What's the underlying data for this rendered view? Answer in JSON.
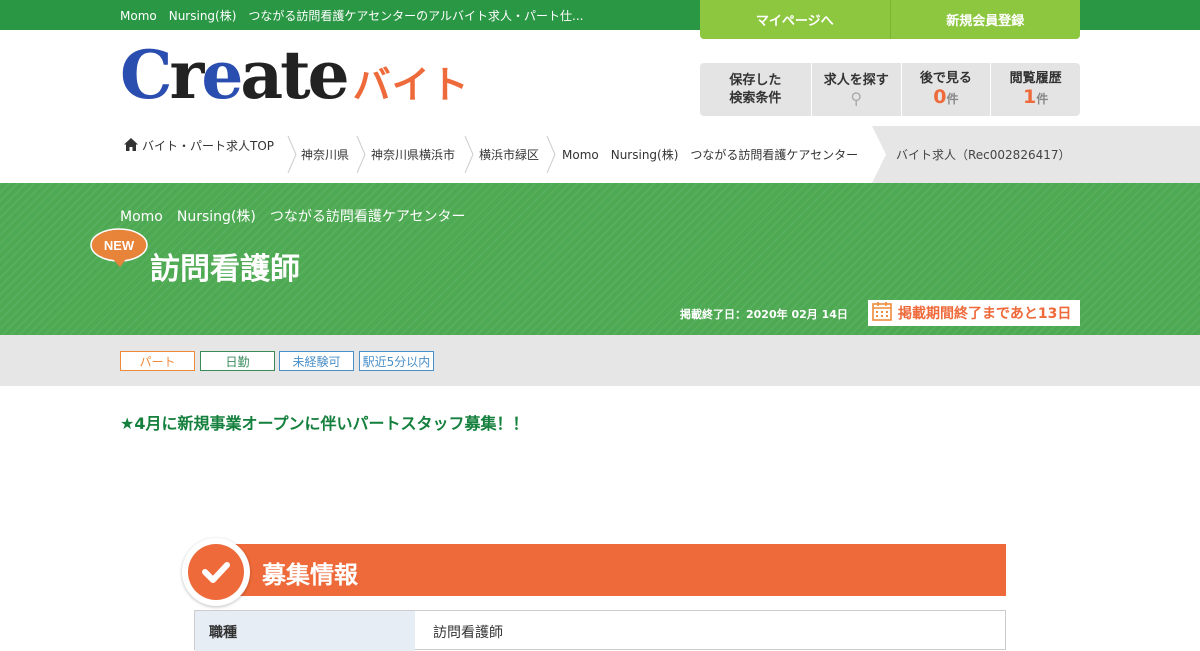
{
  "topbar": {
    "text": "Momo　Nursing(株)　つながる訪問看護ケアセンターのアルバイト求人・パート仕...",
    "mypage_label": "マイページへ",
    "register_label": "新規会員登録"
  },
  "logo": {
    "c": "C",
    "r": "r",
    "e": "e",
    "ate": "ate",
    "baito": "バイト"
  },
  "utility": {
    "saved_line1": "保存した",
    "saved_line2": "検索条件",
    "search_label": "求人を探す",
    "later_label": "後で見る",
    "later_count": "0",
    "later_unit": "件",
    "history_label": "閲覧履歴",
    "history_count": "1",
    "history_unit": "件"
  },
  "breadcrumb": {
    "home": "バイト・パート求人TOP",
    "items": [
      "神奈川県",
      "神奈川県横浜市",
      "横浜市緑区",
      "Momo　Nursing(株)　つながる訪問看護ケアセンター"
    ],
    "current": "バイト求人（Rec002826417）"
  },
  "banner": {
    "company": "Momo　Nursing(株)　つながる訪問看護ケアセンター",
    "new_badge": "NEW",
    "title": "訪問看護師",
    "end_date": "掲載終了日：2020年 02月 14日",
    "remaining": "掲載期間終了まであと13日"
  },
  "tags": [
    {
      "label": "パート",
      "color": "#ee8a3a"
    },
    {
      "label": "日勤",
      "color": "#3a8a5a"
    },
    {
      "label": "未経験可",
      "color": "#4a90c8"
    },
    {
      "label": "駅近5分以内",
      "color": "#4a90c8"
    }
  ],
  "catch_copy": "★4月に新規事業オープンに伴いパートスタッフ募集！！",
  "section": {
    "title": "募集情報",
    "row_label": "職種",
    "row_value": "訪問看護師"
  },
  "colors": {
    "green_top": "#2a9745",
    "lime": "#8dc63f",
    "banner_green": "#4da952",
    "accent_orange": "#ee6a3a",
    "catch_green": "#15803d"
  }
}
